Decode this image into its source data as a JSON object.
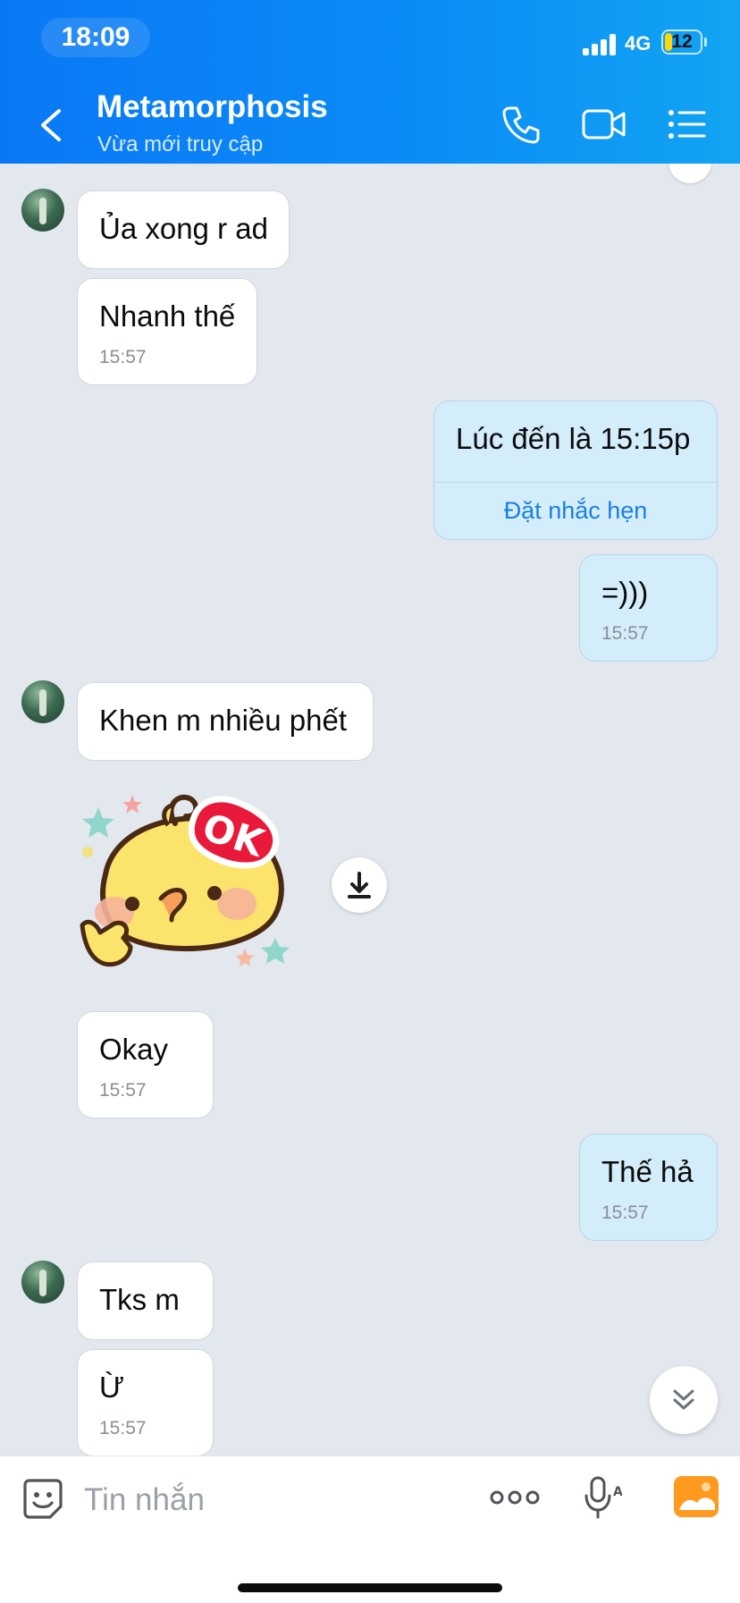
{
  "status_bar": {
    "time": "18:09",
    "network": "4G",
    "battery": "12"
  },
  "header": {
    "title": "Metamorphosis",
    "subtitle": "Vừa mới truy cập"
  },
  "messages": [
    {
      "text": "Ủa xong r ad",
      "time": ""
    },
    {
      "text": "Nhanh thế",
      "time": "15:57"
    },
    {
      "text": "Lúc đến là 15:15p",
      "action": "Đặt nhắc hẹn"
    },
    {
      "text": "=)))",
      "time": "15:57"
    },
    {
      "text": "Khen m nhiều phết",
      "time": ""
    },
    {
      "text": "Okay",
      "time": "15:57"
    },
    {
      "text": "Thế hả",
      "time": "15:57"
    },
    {
      "text": "Tks m",
      "time": ""
    },
    {
      "text": "Ừ",
      "time": "15:57"
    }
  ],
  "sticker": {
    "label": "OK"
  },
  "input": {
    "placeholder": "Tin nhắn"
  },
  "colors": {
    "header": "#0a84f7",
    "outgoing_bubble": "#d4edfb",
    "link": "#1a7fe3",
    "accent_gallery": "#ff9a1f"
  }
}
